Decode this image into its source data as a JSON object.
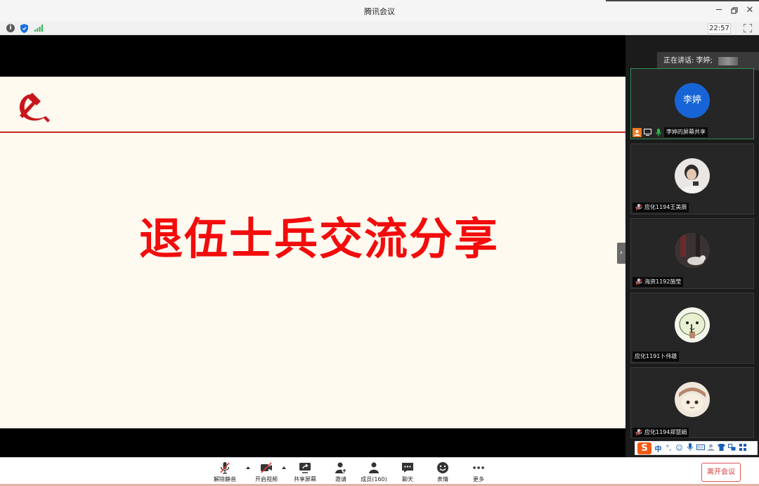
{
  "window": {
    "title": "腾讯会议"
  },
  "infobar": {
    "time": "22:57"
  },
  "slide": {
    "title": "退伍士兵交流分享"
  },
  "sidebar": {
    "speaking": "正在讲话: 李婷;",
    "tiles": [
      {
        "name": "李婷的屏幕共享",
        "avatar_text": "李婷",
        "avatar_color": "#1664d6"
      },
      {
        "name": "应化1194王美辰"
      },
      {
        "name": "海资1192施莹"
      },
      {
        "name": "应化1191卜伟雄"
      },
      {
        "name": "应化1194郑慧娟"
      }
    ]
  },
  "toolbar": {
    "unmute": "解除静音",
    "video": "开启视频",
    "share": "共享屏幕",
    "invite": "邀请",
    "members": "成员(160)",
    "chat": "聊天",
    "reactions": "表情",
    "more": "更多",
    "leave": "离开会议"
  },
  "ime": {
    "logo": "S",
    "mode": "中"
  },
  "colors": {
    "accent_red": "#f20c0c",
    "leave_red": "#d83a3a",
    "avatar_blue": "#1664d6"
  }
}
